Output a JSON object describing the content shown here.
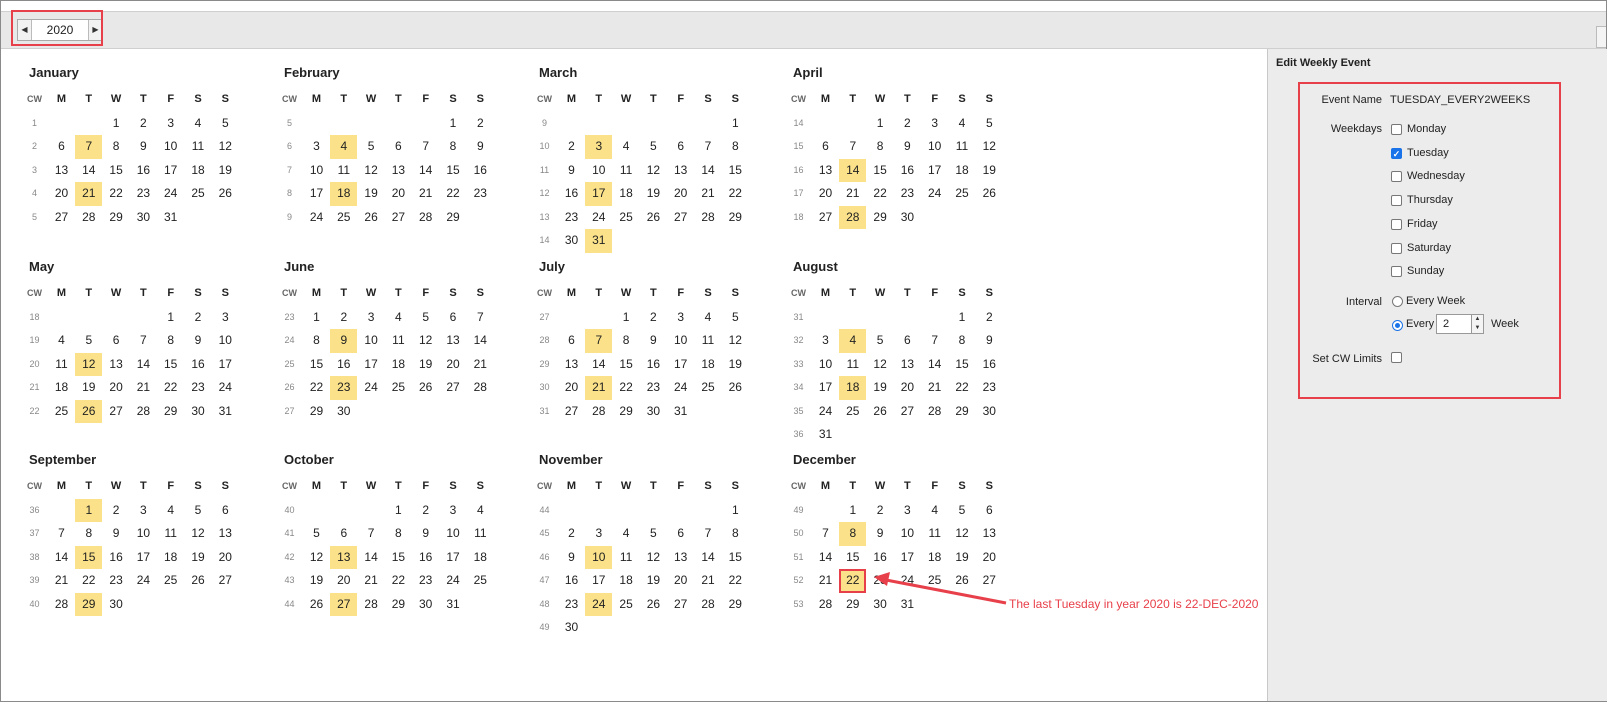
{
  "toolbar": {
    "year": "2020",
    "prev_icon": "triangle-left",
    "next_icon": "triangle-right"
  },
  "calendar": {
    "cw_label": "CW",
    "weekday_headers": [
      "M",
      "T",
      "W",
      "T",
      "F",
      "S",
      "S"
    ],
    "months": [
      {
        "name": "January",
        "cw": [
          "1",
          "2",
          "3",
          "4",
          "5"
        ],
        "weeks": [
          [
            "",
            "",
            "1",
            "2",
            "3",
            "4",
            "5"
          ],
          [
            "6",
            "7",
            "8",
            "9",
            "10",
            "11",
            "12"
          ],
          [
            "13",
            "14",
            "15",
            "16",
            "17",
            "18",
            "19"
          ],
          [
            "20",
            "21",
            "22",
            "23",
            "24",
            "25",
            "26"
          ],
          [
            "27",
            "28",
            "29",
            "30",
            "31",
            "",
            ""
          ]
        ],
        "highlight": [
          "7",
          "21"
        ]
      },
      {
        "name": "February",
        "cw": [
          "5",
          "6",
          "7",
          "8",
          "9"
        ],
        "weeks": [
          [
            "",
            "",
            "",
            "",
            "",
            "1",
            "2"
          ],
          [
            "3",
            "4",
            "5",
            "6",
            "7",
            "8",
            "9"
          ],
          [
            "10",
            "11",
            "12",
            "13",
            "14",
            "15",
            "16"
          ],
          [
            "17",
            "18",
            "19",
            "20",
            "21",
            "22",
            "23"
          ],
          [
            "24",
            "25",
            "26",
            "27",
            "28",
            "29",
            ""
          ]
        ],
        "highlight": [
          "4",
          "18"
        ]
      },
      {
        "name": "March",
        "cw": [
          "9",
          "10",
          "11",
          "12",
          "13",
          "14"
        ],
        "weeks": [
          [
            "",
            "",
            "",
            "",
            "",
            "",
            "1"
          ],
          [
            "2",
            "3",
            "4",
            "5",
            "6",
            "7",
            "8"
          ],
          [
            "9",
            "10",
            "11",
            "12",
            "13",
            "14",
            "15"
          ],
          [
            "16",
            "17",
            "18",
            "19",
            "20",
            "21",
            "22"
          ],
          [
            "23",
            "24",
            "25",
            "26",
            "27",
            "28",
            "29"
          ],
          [
            "30",
            "31",
            "",
            "",
            "",
            "",
            ""
          ]
        ],
        "highlight": [
          "3",
          "17",
          "31"
        ]
      },
      {
        "name": "April",
        "cw": [
          "14",
          "15",
          "16",
          "17",
          "18"
        ],
        "weeks": [
          [
            "",
            "",
            "1",
            "2",
            "3",
            "4",
            "5"
          ],
          [
            "6",
            "7",
            "8",
            "9",
            "10",
            "11",
            "12"
          ],
          [
            "13",
            "14",
            "15",
            "16",
            "17",
            "18",
            "19"
          ],
          [
            "20",
            "21",
            "22",
            "23",
            "24",
            "25",
            "26"
          ],
          [
            "27",
            "28",
            "29",
            "30",
            "",
            "",
            ""
          ]
        ],
        "highlight": [
          "14",
          "28"
        ]
      },
      {
        "name": "May",
        "cw": [
          "18",
          "19",
          "20",
          "21",
          "22"
        ],
        "weeks": [
          [
            "",
            "",
            "",
            "",
            "1",
            "2",
            "3"
          ],
          [
            "4",
            "5",
            "6",
            "7",
            "8",
            "9",
            "10"
          ],
          [
            "11",
            "12",
            "13",
            "14",
            "15",
            "16",
            "17"
          ],
          [
            "18",
            "19",
            "20",
            "21",
            "22",
            "23",
            "24"
          ],
          [
            "25",
            "26",
            "27",
            "28",
            "29",
            "30",
            "31"
          ]
        ],
        "highlight": [
          "12",
          "26"
        ]
      },
      {
        "name": "June",
        "cw": [
          "23",
          "24",
          "25",
          "26",
          "27"
        ],
        "weeks": [
          [
            "1",
            "2",
            "3",
            "4",
            "5",
            "6",
            "7"
          ],
          [
            "8",
            "9",
            "10",
            "11",
            "12",
            "13",
            "14"
          ],
          [
            "15",
            "16",
            "17",
            "18",
            "19",
            "20",
            "21"
          ],
          [
            "22",
            "23",
            "24",
            "25",
            "26",
            "27",
            "28"
          ],
          [
            "29",
            "30",
            "",
            "",
            "",
            "",
            ""
          ]
        ],
        "highlight": [
          "9",
          "23"
        ]
      },
      {
        "name": "July",
        "cw": [
          "27",
          "28",
          "29",
          "30",
          "31"
        ],
        "weeks": [
          [
            "",
            "",
            "1",
            "2",
            "3",
            "4",
            "5"
          ],
          [
            "6",
            "7",
            "8",
            "9",
            "10",
            "11",
            "12"
          ],
          [
            "13",
            "14",
            "15",
            "16",
            "17",
            "18",
            "19"
          ],
          [
            "20",
            "21",
            "22",
            "23",
            "24",
            "25",
            "26"
          ],
          [
            "27",
            "28",
            "29",
            "30",
            "31",
            "",
            ""
          ]
        ],
        "highlight": [
          "7",
          "21"
        ]
      },
      {
        "name": "August",
        "cw": [
          "31",
          "32",
          "33",
          "34",
          "35",
          "36"
        ],
        "weeks": [
          [
            "",
            "",
            "",
            "",
            "",
            "1",
            "2"
          ],
          [
            "3",
            "4",
            "5",
            "6",
            "7",
            "8",
            "9"
          ],
          [
            "10",
            "11",
            "12",
            "13",
            "14",
            "15",
            "16"
          ],
          [
            "17",
            "18",
            "19",
            "20",
            "21",
            "22",
            "23"
          ],
          [
            "24",
            "25",
            "26",
            "27",
            "28",
            "29",
            "30"
          ],
          [
            "31",
            "",
            "",
            "",
            "",
            "",
            ""
          ]
        ],
        "highlight": [
          "4",
          "18"
        ]
      },
      {
        "name": "September",
        "cw": [
          "36",
          "37",
          "38",
          "39",
          "40"
        ],
        "weeks": [
          [
            "",
            "1",
            "2",
            "3",
            "4",
            "5",
            "6"
          ],
          [
            "7",
            "8",
            "9",
            "10",
            "11",
            "12",
            "13"
          ],
          [
            "14",
            "15",
            "16",
            "17",
            "18",
            "19",
            "20"
          ],
          [
            "21",
            "22",
            "23",
            "24",
            "25",
            "26",
            "27"
          ],
          [
            "28",
            "29",
            "30",
            "",
            "",
            "",
            ""
          ]
        ],
        "highlight": [
          "1",
          "15",
          "29"
        ]
      },
      {
        "name": "October",
        "cw": [
          "40",
          "41",
          "42",
          "43",
          "44"
        ],
        "weeks": [
          [
            "",
            "",
            "",
            "1",
            "2",
            "3",
            "4"
          ],
          [
            "5",
            "6",
            "7",
            "8",
            "9",
            "10",
            "11"
          ],
          [
            "12",
            "13",
            "14",
            "15",
            "16",
            "17",
            "18"
          ],
          [
            "19",
            "20",
            "21",
            "22",
            "23",
            "24",
            "25"
          ],
          [
            "26",
            "27",
            "28",
            "29",
            "30",
            "31",
            ""
          ]
        ],
        "highlight": [
          "13",
          "27"
        ]
      },
      {
        "name": "November",
        "cw": [
          "44",
          "45",
          "46",
          "47",
          "48",
          "49"
        ],
        "weeks": [
          [
            "",
            "",
            "",
            "",
            "",
            "",
            "1"
          ],
          [
            "2",
            "3",
            "4",
            "5",
            "6",
            "7",
            "8"
          ],
          [
            "9",
            "10",
            "11",
            "12",
            "13",
            "14",
            "15"
          ],
          [
            "16",
            "17",
            "18",
            "19",
            "20",
            "21",
            "22"
          ],
          [
            "23",
            "24",
            "25",
            "26",
            "27",
            "28",
            "29"
          ],
          [
            "30",
            "",
            "",
            "",
            "",
            "",
            ""
          ]
        ],
        "highlight": [
          "10",
          "24"
        ]
      },
      {
        "name": "December",
        "cw": [
          "49",
          "50",
          "51",
          "52",
          "53"
        ],
        "weeks": [
          [
            "",
            "1",
            "2",
            "3",
            "4",
            "5",
            "6"
          ],
          [
            "7",
            "8",
            "9",
            "10",
            "11",
            "12",
            "13"
          ],
          [
            "14",
            "15",
            "16",
            "17",
            "18",
            "19",
            "20"
          ],
          [
            "21",
            "22",
            "23",
            "24",
            "25",
            "26",
            "27"
          ],
          [
            "28",
            "29",
            "30",
            "31",
            "",
            "",
            ""
          ]
        ],
        "highlight": [
          "8",
          "22"
        ],
        "outlined": "22"
      }
    ]
  },
  "panel": {
    "title": "Edit Weekly Event",
    "event_name_label": "Event Name",
    "event_name_value": "TUESDAY_EVERY2WEEKS",
    "weekdays_label": "Weekdays",
    "weekdays": [
      {
        "label": "Monday",
        "checked": false
      },
      {
        "label": "Tuesday",
        "checked": true
      },
      {
        "label": "Wednesday",
        "checked": false
      },
      {
        "label": "Thursday",
        "checked": false
      },
      {
        "label": "Friday",
        "checked": false
      },
      {
        "label": "Saturday",
        "checked": false
      },
      {
        "label": "Sunday",
        "checked": false
      }
    ],
    "interval_label": "Interval",
    "every_week_label": "Every Week",
    "every_label": "Every",
    "interval_value": "2",
    "week_label": "Week",
    "cw_limits_label": "Set CW Limits"
  },
  "annotation": {
    "text": "The last Tuesday in year 2020 is 22-DEC-2020"
  },
  "colors": {
    "highlight": "#fbe28a",
    "annotation": "#e8404a",
    "check": "#1a73e8"
  }
}
